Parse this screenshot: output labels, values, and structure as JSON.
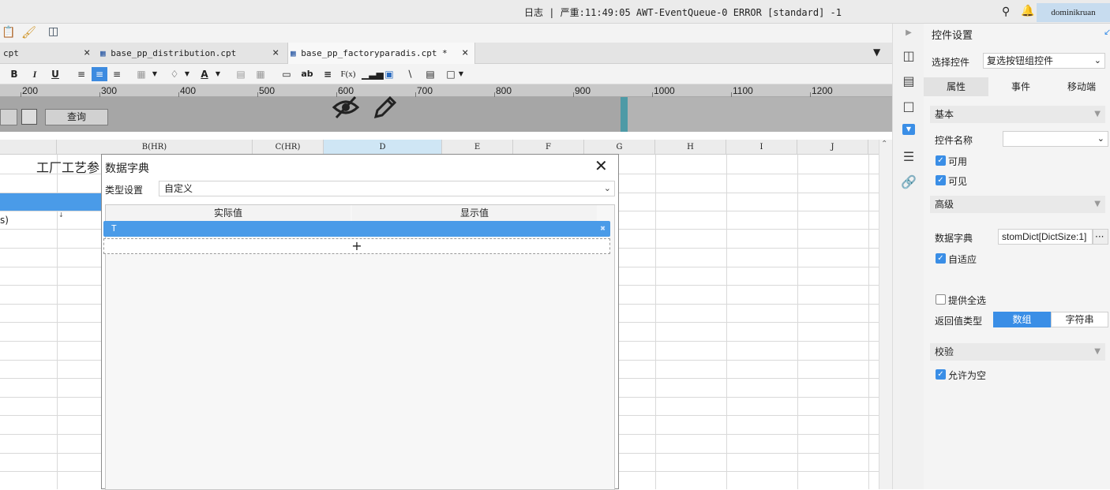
{
  "topbar": {
    "log_text": "日志 | 严重:11:49:05 AWT-EventQueue-0 ERROR [standard] -1",
    "user": "dominikruan"
  },
  "tabs": [
    {
      "label": "cpt"
    },
    {
      "label": "base_pp_distribution.cpt"
    },
    {
      "label": "base_pp_factoryparadis.cpt *"
    }
  ],
  "toolbar": {
    "bold": "B",
    "italic": "I",
    "underline": "U",
    "wrap": "ab",
    "formula": "F(x)"
  },
  "ruler": {
    "labels": [
      "200",
      "300",
      "400",
      "500",
      "600",
      "700",
      "800",
      "900",
      "1000",
      "1100",
      "1200"
    ]
  },
  "param_panel": {
    "query_button": "查询"
  },
  "grid": {
    "columns": [
      "B(HR)",
      "C(HR)",
      "D",
      "E",
      "F",
      "G",
      "H",
      "I",
      "J"
    ],
    "cell_title": "工厂工艺参",
    "cell_partial": "s)"
  },
  "dialog": {
    "title": "数据字典",
    "type_label": "类型设置",
    "type_value": "自定义",
    "columns": [
      "实际值",
      "显示值"
    ],
    "rows": [
      {
        "actual": "T",
        "display": ""
      }
    ],
    "add_symbol": "+"
  },
  "right_panel": {
    "title": "控件设置",
    "select_control_label": "选择控件",
    "select_control_value": "复选按钮组控件",
    "tabs": [
      "属性",
      "事件",
      "移动端"
    ],
    "active_tab": "属性",
    "sections": {
      "basic": "基本",
      "advanced": "高级",
      "validate": "校验"
    },
    "widget_name_label": "控件名称",
    "widget_name_value": "",
    "enabled_label": "可用",
    "visible_label": "可见",
    "dict_label": "数据字典",
    "dict_value": "stomDict[DictSize:1]",
    "dict_more": "···",
    "adaptive_label": "自适应",
    "select_all_label": "提供全选",
    "return_type_label": "返回值类型",
    "return_type_options": [
      "数组",
      "字符串"
    ],
    "return_type_selected": "数组",
    "allow_empty_label": "允许为空"
  },
  "colors": {
    "accent": "#3a8ee6",
    "selected_row": "#4a9be8",
    "param_marker": "#4e9aa6"
  }
}
